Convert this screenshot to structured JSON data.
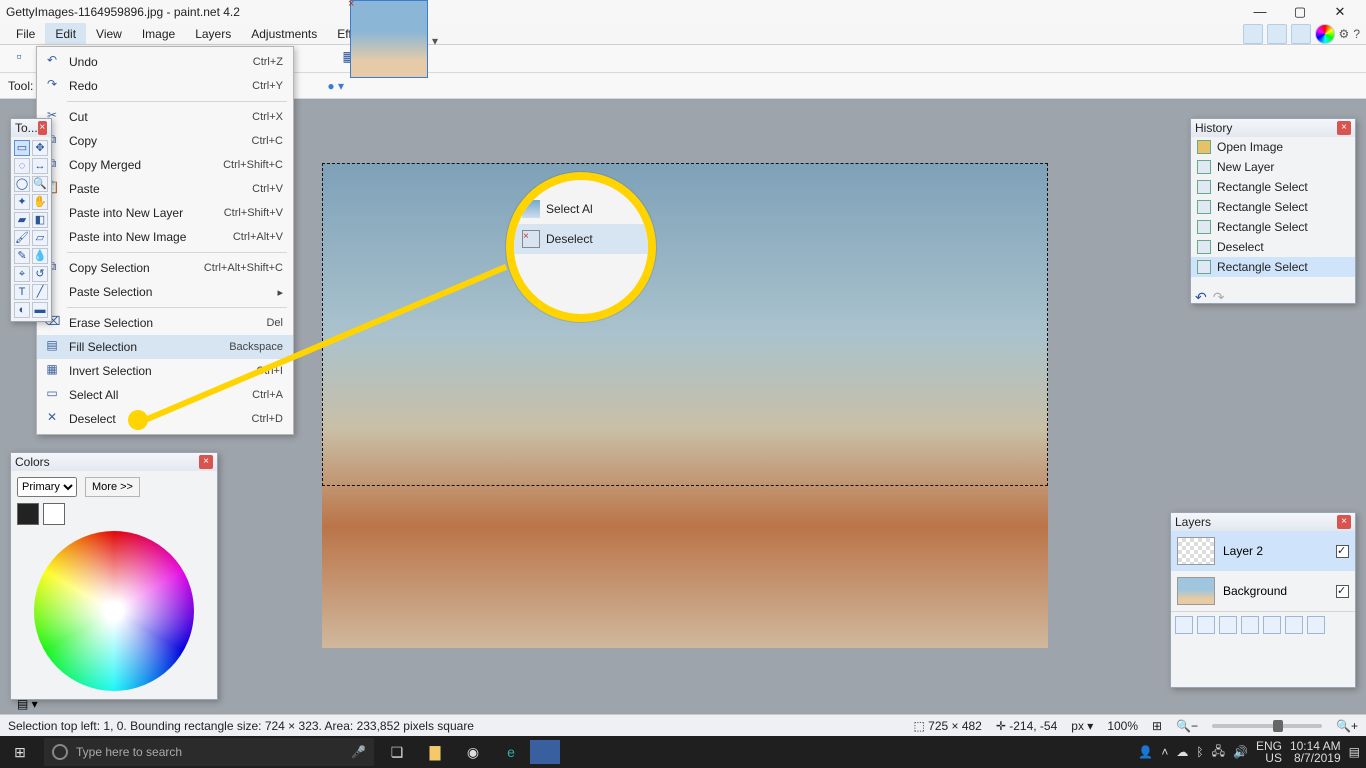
{
  "window": {
    "title": "GettyImages-1164959896.jpg - paint.net 4.2"
  },
  "menu": {
    "items": [
      "File",
      "Edit",
      "View",
      "Image",
      "Layers",
      "Adjustments",
      "Effects"
    ],
    "open": "Edit"
  },
  "toolrow2": {
    "label": "Tool:"
  },
  "editmenu": [
    {
      "icon": "↶",
      "label": "Undo",
      "shortcut": "Ctrl+Z"
    },
    {
      "icon": "↷",
      "label": "Redo",
      "shortcut": "Ctrl+Y"
    },
    {
      "sep": true
    },
    {
      "icon": "✂",
      "label": "Cut",
      "shortcut": "Ctrl+X"
    },
    {
      "icon": "⧉",
      "label": "Copy",
      "shortcut": "Ctrl+C"
    },
    {
      "icon": "⧉",
      "label": "Copy Merged",
      "shortcut": "Ctrl+Shift+C"
    },
    {
      "icon": "📋",
      "label": "Paste",
      "shortcut": "Ctrl+V"
    },
    {
      "icon": "",
      "label": "Paste into New Layer",
      "shortcut": "Ctrl+Shift+V"
    },
    {
      "icon": "",
      "label": "Paste into New Image",
      "shortcut": "Ctrl+Alt+V"
    },
    {
      "sep": true
    },
    {
      "icon": "⧉",
      "label": "Copy Selection",
      "shortcut": "Ctrl+Alt+Shift+C"
    },
    {
      "icon": "",
      "label": "Paste Selection",
      "shortcut": "▸"
    },
    {
      "sep": true
    },
    {
      "icon": "⌫",
      "label": "Erase Selection",
      "shortcut": "Del"
    },
    {
      "icon": "▤",
      "label": "Fill Selection",
      "shortcut": "Backspace",
      "hover": true
    },
    {
      "icon": "▦",
      "label": "Invert Selection",
      "shortcut": "Ctrl+I"
    },
    {
      "icon": "▭",
      "label": "Select All",
      "shortcut": "Ctrl+A"
    },
    {
      "icon": "✕",
      "label": "Deselect",
      "shortcut": "Ctrl+D",
      "dot": true
    }
  ],
  "spotlight": {
    "row1": "Select Al",
    "row2": "Deselect"
  },
  "toolsPanel": {
    "title": "To..."
  },
  "colorsPanel": {
    "title": "Colors",
    "mode": "Primary",
    "more": "More >>"
  },
  "historyPanel": {
    "title": "History",
    "items": [
      {
        "icon": "folder",
        "label": "Open Image"
      },
      {
        "icon": "layer",
        "label": "New Layer"
      },
      {
        "icon": "rect",
        "label": "Rectangle Select"
      },
      {
        "icon": "rect",
        "label": "Rectangle Select"
      },
      {
        "icon": "rect",
        "label": "Rectangle Select"
      },
      {
        "icon": "desel",
        "label": "Deselect"
      },
      {
        "icon": "rect",
        "label": "Rectangle Select",
        "sel": true
      }
    ]
  },
  "layersPanel": {
    "title": "Layers",
    "items": [
      {
        "name": "Layer 2",
        "checked": true,
        "sel": true,
        "thumb": "checker"
      },
      {
        "name": "Background",
        "checked": true,
        "thumb": "bg"
      }
    ]
  },
  "status": {
    "sel": "Selection top left: 1, 0. Bounding rectangle size: 724 × 323. Area: 233,852 pixels square",
    "imgsize": "725 × 482",
    "cursor": "-214, -54",
    "unit": "px",
    "zoom": "100%"
  },
  "taskbar": {
    "searchPlaceholder": "Type here to search",
    "lang1": "ENG",
    "lang2": "US",
    "time": "10:14 AM",
    "date": "8/7/2019"
  }
}
